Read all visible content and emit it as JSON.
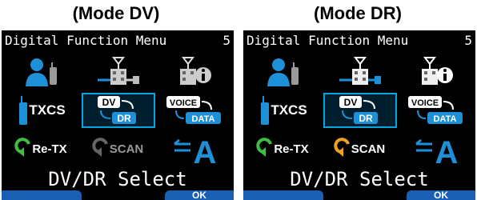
{
  "captions": {
    "left": "(Mode DV)",
    "right": "(Mode DR)"
  },
  "screens": [
    {
      "mode": "DV",
      "title": "Digital Function Menu",
      "page_number": "5",
      "items": {
        "txcs": "TXCS",
        "dv": "DV",
        "dr": "DR",
        "voice": "VOICE",
        "data": "DATA",
        "retx": "Re-TX",
        "scan": "SCAN",
        "scan_enabled": false
      },
      "status": "DV/DR Select",
      "softkeys": {
        "left": "",
        "right": "OK"
      }
    },
    {
      "mode": "DR",
      "title": "Digital Function Menu",
      "page_number": "5",
      "items": {
        "txcs": "TXCS",
        "dv": "DV",
        "dr": "DR",
        "voice": "VOICE",
        "data": "DATA",
        "retx": "Re-TX",
        "scan": "SCAN",
        "scan_enabled": true
      },
      "status": "DV/DR Select",
      "softkeys": {
        "left": "",
        "right": "OK"
      }
    }
  ],
  "colors": {
    "screen_bg": "#000000",
    "selection_outline": "#00a6e0",
    "icon_blue": "#1e90d8",
    "softkey_blue": "#1a5fb4",
    "retx_green": "#3fbf3f",
    "scan_orange": "#f0a020"
  },
  "icons": [
    "user-icon",
    "repeater-icon",
    "repeater-info-icon",
    "txcs-radio-icon",
    "dv-dr-switch-icon",
    "voice-data-switch-icon",
    "retx-icon",
    "scan-icon",
    "font-a-icon"
  ]
}
